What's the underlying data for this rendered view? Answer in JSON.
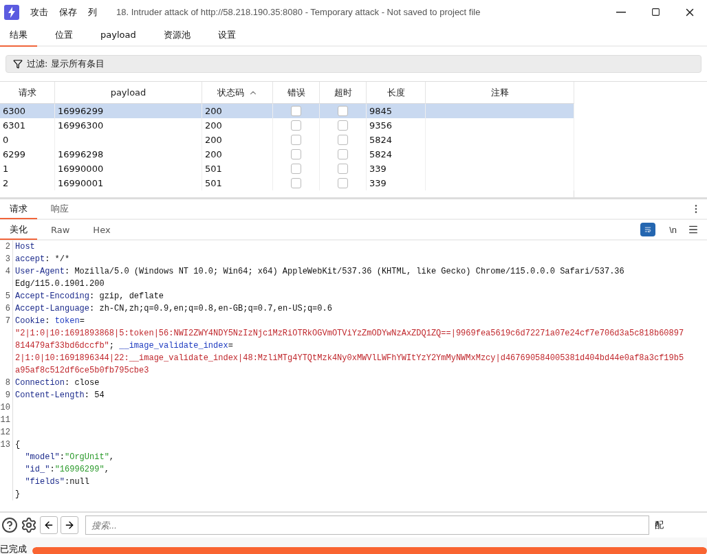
{
  "window": {
    "menu": [
      "攻击",
      "保存",
      "列"
    ],
    "title": "18. Intruder attack of http://58.218.190.35:8080 - Temporary attack - Not saved to project file"
  },
  "tabs": [
    {
      "label": "结果",
      "selected": true
    },
    {
      "label": "位置",
      "selected": false
    },
    {
      "label": "payload",
      "selected": false
    },
    {
      "label": "资源池",
      "selected": false
    },
    {
      "label": "设置",
      "selected": false
    }
  ],
  "filter": {
    "label": "过滤: 显示所有条目"
  },
  "table": {
    "columns": [
      "请求",
      "payload",
      "状态码",
      "错误",
      "超时",
      "长度",
      "注释"
    ],
    "rows": [
      {
        "request": "6300",
        "payload": "16996299",
        "status": "200",
        "error": false,
        "timeout": false,
        "length": "9845",
        "selected": true
      },
      {
        "request": "6301",
        "payload": "16996300",
        "status": "200",
        "error": false,
        "timeout": false,
        "length": "9356",
        "selected": false
      },
      {
        "request": "0",
        "status": "200",
        "error": false,
        "timeout": false,
        "length": "5824",
        "selected": false
      },
      {
        "request": "6299",
        "payload": "16996298",
        "status": "200",
        "error": false,
        "timeout": false,
        "length": "5824",
        "selected": false
      },
      {
        "request": "1",
        "payload": "16990000",
        "status": "501",
        "error": false,
        "timeout": false,
        "length": "339",
        "selected": false
      },
      {
        "request": "2",
        "payload": "16990001",
        "status": "501",
        "error": false,
        "timeout": false,
        "length": "339",
        "selected": false
      }
    ]
  },
  "message_tabs": [
    {
      "label": "请求",
      "selected": true
    },
    {
      "label": "响应",
      "selected": false
    }
  ],
  "view_tabs": [
    {
      "label": "美化",
      "selected": true
    },
    {
      "label": "Raw",
      "selected": false
    },
    {
      "label": "Hex",
      "selected": false
    }
  ],
  "wrap_toggle": {
    "label": "\\n"
  },
  "code": [
    {
      "number": "2",
      "parts": [
        {
          "kind": "key",
          "text": "Host"
        }
      ]
    },
    {
      "number": "3",
      "parts": [
        {
          "kind": "key",
          "text": "accept"
        },
        {
          "kind": "plain",
          "text": ": */*"
        }
      ]
    },
    {
      "number": "4",
      "parts": [
        {
          "kind": "key",
          "text": "User-Agent"
        },
        {
          "kind": "plain",
          "text": ": Mozilla/5.0 (Windows NT 10.0; Win64; x64) AppleWebKit/537.36 (KHTML, like Gecko) Chrome/115.0.0.0 Safari/537.36"
        }
      ]
    },
    {
      "parts": [
        {
          "kind": "plain",
          "text": "Edg/115.0.1901.200"
        }
      ]
    },
    {
      "number": "5",
      "parts": [
        {
          "kind": "key",
          "text": "Accept-Encoding"
        },
        {
          "kind": "plain",
          "text": ": gzip, deflate"
        }
      ]
    },
    {
      "number": "6",
      "parts": [
        {
          "kind": "key",
          "text": "Accept-Language"
        },
        {
          "kind": "plain",
          "text": ": zh-CN,zh;q=0.9,en;q=0.8,en-GB;q=0.7,en-US;q=0.6"
        }
      ]
    },
    {
      "number": "7",
      "parts": [
        {
          "kind": "key",
          "text": "Cookie"
        },
        {
          "kind": "plain",
          "text": ": "
        },
        {
          "kind": "name",
          "text": "token"
        },
        {
          "kind": "plain",
          "text": "="
        }
      ]
    },
    {
      "parts": [
        {
          "kind": "value",
          "text": "\"2|1:0|10:1691893868|5:token|56:NWI2ZWY4NDY5NzIzNjc1MzRiOTRkOGVmOTViYzZmODYwNzAxZDQ1ZQ==|9969fea5619c6d72271a07e24cf7e706d3a5c818b60897"
        }
      ]
    },
    {
      "parts": [
        {
          "kind": "value",
          "text": "814479af33bd6dccfb\""
        },
        {
          "kind": "plain",
          "text": "; "
        },
        {
          "kind": "name",
          "text": "__image_validate_index"
        },
        {
          "kind": "plain",
          "text": "="
        }
      ]
    },
    {
      "parts": [
        {
          "kind": "value",
          "text": "2|1:0|10:1691896344|22:__image_validate_index|48:MzliMTg4YTQtMzk4Ny0xMWVlLWFhYWItYzY2YmMyNWMxMzcy|d467690584005381d404bd44e0af8a3cf19b5"
        }
      ]
    },
    {
      "parts": [
        {
          "kind": "value",
          "text": "a95af8c512df6ce5b0fb795cbe3"
        }
      ]
    },
    {
      "number": "8",
      "parts": [
        {
          "kind": "key",
          "text": "Connection"
        },
        {
          "kind": "plain",
          "text": ": close"
        }
      ]
    },
    {
      "number": "9",
      "parts": [
        {
          "kind": "key",
          "text": "Content-Length"
        },
        {
          "kind": "plain",
          "text": ": 54"
        }
      ]
    },
    {
      "number": "10"
    },
    {
      "number": "11"
    },
    {
      "number": "12"
    },
    {
      "number": "13",
      "parts": [
        {
          "kind": "plain",
          "text": "{"
        }
      ]
    },
    {
      "parts": [
        {
          "kind": "jkey",
          "text": "  \"model\""
        },
        {
          "kind": "plain",
          "text": ":"
        },
        {
          "kind": "jstr",
          "text": "\"OrgUnit\""
        },
        {
          "kind": "plain",
          "text": ","
        }
      ]
    },
    {
      "parts": [
        {
          "kind": "jkey",
          "text": "  \"id_\""
        },
        {
          "kind": "plain",
          "text": ":"
        },
        {
          "kind": "jstr",
          "text": "\"16996299\""
        },
        {
          "kind": "plain",
          "text": ","
        }
      ]
    },
    {
      "parts": [
        {
          "kind": "jkey",
          "text": "  \"fields\""
        },
        {
          "kind": "plain",
          "text": ":null"
        }
      ]
    },
    {
      "parts": [
        {
          "kind": "plain",
          "text": "}"
        }
      ]
    }
  ],
  "search": {
    "placeholder": "搜索...",
    "matches": "配"
  },
  "status_bar": {
    "label": "已完成",
    "level": 1
  }
}
